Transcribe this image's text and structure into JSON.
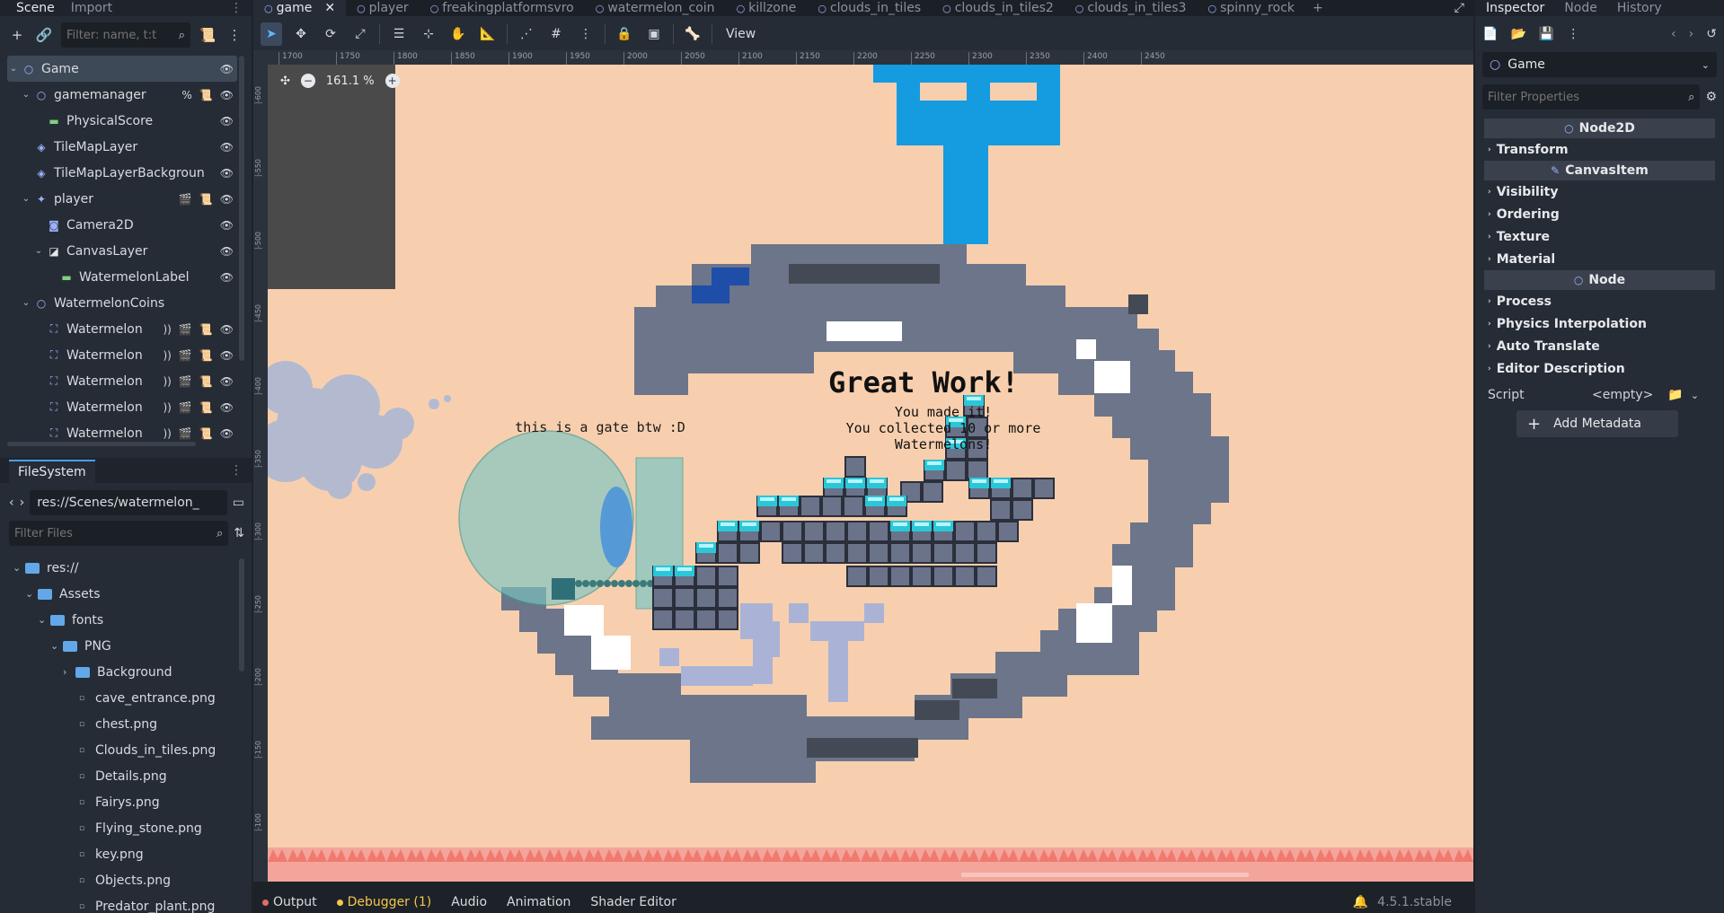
{
  "left_dock": {
    "tabs": [
      "Scene",
      "Import"
    ],
    "filter_placeholder": "Filter: name, t:t",
    "tree": [
      {
        "label": "Game",
        "depth": 0,
        "expanded": true,
        "selected": true
      },
      {
        "label": "gamemanager",
        "depth": 1,
        "expanded": true,
        "extra": "%"
      },
      {
        "label": "PhysicalScore",
        "depth": 2
      },
      {
        "label": "TileMapLayer",
        "depth": 1
      },
      {
        "label": "TileMapLayerBackgroun",
        "depth": 1
      },
      {
        "label": "player",
        "depth": 1,
        "expanded": true
      },
      {
        "label": "Camera2D",
        "depth": 2
      },
      {
        "label": "CanvasLayer",
        "depth": 2,
        "expanded": true
      },
      {
        "label": "WatermelonLabel",
        "depth": 3
      },
      {
        "label": "WatermelonCoins",
        "depth": 1,
        "expanded": true
      },
      {
        "label": "Watermelon",
        "depth": 2
      },
      {
        "label": "Watermelon",
        "depth": 2
      },
      {
        "label": "Watermelon",
        "depth": 2
      },
      {
        "label": "Watermelon",
        "depth": 2
      },
      {
        "label": "Watermelon",
        "depth": 2
      }
    ]
  },
  "filesystem": {
    "tab": "FileSystem",
    "path": "res://Scenes/watermelon_",
    "filter_placeholder": "Filter Files",
    "items": [
      {
        "label": "res://",
        "type": "folder",
        "depth": 0
      },
      {
        "label": "Assets",
        "type": "folder",
        "depth": 1
      },
      {
        "label": "fonts",
        "type": "folder",
        "depth": 2
      },
      {
        "label": "PNG",
        "type": "folder",
        "depth": 3
      },
      {
        "label": "Background",
        "type": "folder",
        "depth": 4,
        "collapsed": true
      },
      {
        "label": "cave_entrance.png",
        "type": "file",
        "depth": 4
      },
      {
        "label": "chest.png",
        "type": "file",
        "depth": 4
      },
      {
        "label": "Clouds_in_tiles.png",
        "type": "file",
        "depth": 4
      },
      {
        "label": "Details.png",
        "type": "file",
        "depth": 4
      },
      {
        "label": "Fairys.png",
        "type": "file",
        "depth": 4
      },
      {
        "label": "Flying_stone.png",
        "type": "file",
        "depth": 4
      },
      {
        "label": "key.png",
        "type": "file",
        "depth": 4
      },
      {
        "label": "Objects.png",
        "type": "file",
        "depth": 4
      },
      {
        "label": "Predator_plant.png",
        "type": "file",
        "depth": 4
      }
    ]
  },
  "scene_tabs": [
    {
      "label": "game",
      "active": true
    },
    {
      "label": "player"
    },
    {
      "label": "freakingplatformsvro"
    },
    {
      "label": "watermelon_coin"
    },
    {
      "label": "killzone"
    },
    {
      "label": "clouds_in_tiles"
    },
    {
      "label": "clouds_in_tiles2"
    },
    {
      "label": "clouds_in_tiles3"
    },
    {
      "label": "spinny_rock"
    }
  ],
  "viewport_toolbar": {
    "view_label": "View"
  },
  "viewport": {
    "zoom": "161.1 %",
    "ruler_ticks": [
      "1700",
      "1750",
      "1800",
      "1850",
      "1900",
      "1950",
      "2000",
      "2050",
      "2100",
      "2150",
      "2200",
      "2250",
      "2300",
      "2350",
      "2400",
      "2450"
    ],
    "ruler_left_ticks": [
      "-600",
      "-550",
      "-500",
      "-450",
      "-400",
      "-350",
      "-300",
      "-250",
      "-200",
      "-150",
      "-100"
    ],
    "gate_text": "this is a gate btw :D",
    "title": "Great Work!",
    "message_lines": [
      "You made it!",
      "You collected 10 or more",
      "Watermelons!"
    ]
  },
  "bottom_bar": {
    "items": [
      "Output",
      "Debugger (1)",
      "Audio",
      "Animation",
      "Shader Editor"
    ],
    "version": "4.5.1.stable"
  },
  "inspector": {
    "tabs": [
      "Inspector",
      "Node",
      "History"
    ],
    "object": "Game",
    "filter_placeholder": "Filter Properties",
    "sections": [
      {
        "head": "Node2D",
        "groups": [
          "Transform"
        ]
      },
      {
        "head": "CanvasItem",
        "groups": [
          "Visibility",
          "Ordering",
          "Texture",
          "Material"
        ]
      },
      {
        "head": "Node",
        "groups": [
          "Process",
          "Physics Interpolation",
          "Auto Translate",
          "Editor Description"
        ]
      }
    ],
    "script_label": "Script",
    "script_value": "<empty>",
    "add_metadata": "Add Metadata"
  },
  "colors": {
    "accent": "#4a9df8",
    "viewport_bg": "#f8cfae",
    "stone": "#6c7589",
    "dark_stone": "#444a55",
    "blue": "#159be0",
    "gem": "#2ac7d8"
  }
}
